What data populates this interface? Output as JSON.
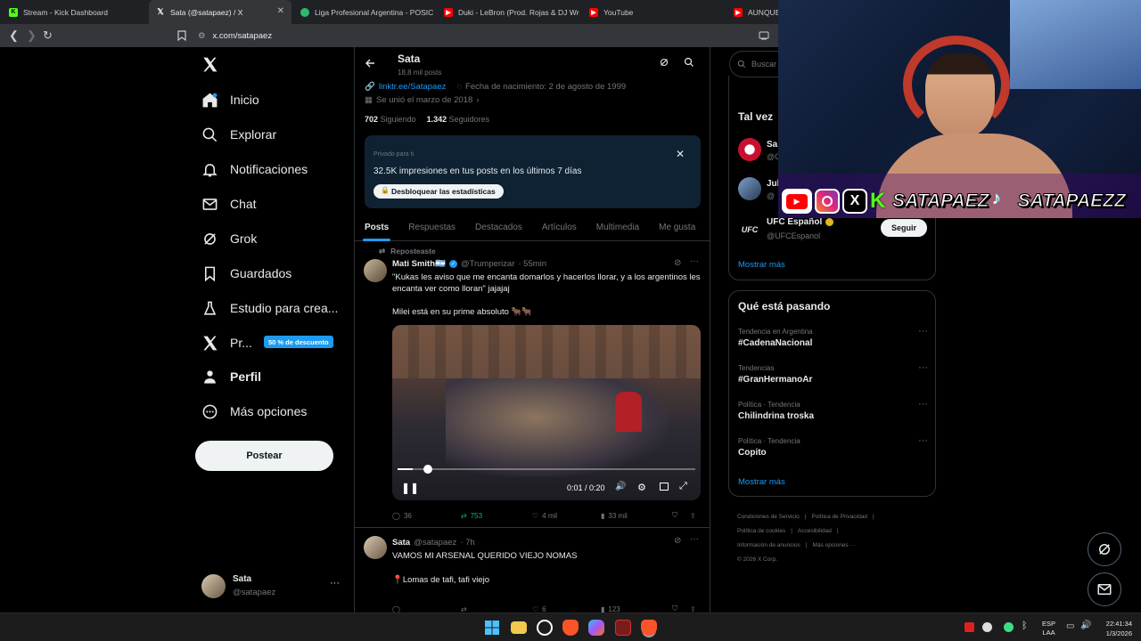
{
  "browser": {
    "tabs": [
      {
        "label": "Stream - Kick Dashboard",
        "icon": "kick-icon",
        "color": "#53fc18"
      },
      {
        "label": "Sata (@satapaez) / X",
        "icon": "x-icon",
        "color": "#ffffff"
      },
      {
        "label": "Liga Profesional Argentina - POSICIO",
        "icon": "liga-icon",
        "color": "#2eb872"
      },
      {
        "label": "Duki - LeBron (Prod. Rojas & DJ Wre",
        "icon": "youtube-icon",
        "color": "#ff0000"
      },
      {
        "label": "YouTube",
        "icon": "youtube-icon",
        "color": "#ff0000"
      },
      {
        "label": "AUNQUE",
        "icon": "youtube-icon",
        "color": "#ff0000"
      }
    ],
    "url": "x.com/satapaez"
  },
  "nav": {
    "items": [
      {
        "label": "Inicio",
        "icon": "home-icon"
      },
      {
        "label": "Explorar",
        "icon": "search-icon"
      },
      {
        "label": "Notificaciones",
        "icon": "bell-icon"
      },
      {
        "label": "Chat",
        "icon": "mail-icon"
      },
      {
        "label": "Grok",
        "icon": "grok-icon"
      },
      {
        "label": "Guardados",
        "icon": "bookmark-icon"
      },
      {
        "label": "Estudio para crea...",
        "icon": "flask-icon"
      },
      {
        "label": "Pr...",
        "icon": "x-logo-icon"
      },
      {
        "label": "Perfil",
        "icon": "person-icon"
      },
      {
        "label": "Más opciones",
        "icon": "more-circle-icon"
      }
    ],
    "premium_badge": "50 % de descuento",
    "post_button": "Postear",
    "account": {
      "name": "Sata",
      "handle": "@satapaez",
      "more": "···"
    }
  },
  "profile": {
    "name": "Sata",
    "posts_count": "18,8 mil posts",
    "link": "linktr.ee/Satapaez",
    "birthday": "Fecha de nacimiento: 2 de agosto de 1999",
    "joined": "Se unió el marzo de 2018",
    "following_count": "702",
    "following_label": "Siguiendo",
    "followers_count": "1.342",
    "followers_label": "Seguidores",
    "promo": {
      "kicker": "Privado para ti",
      "text": "32.5K impresiones en tus posts en los últimos 7 días",
      "button": "Desbloquear las estadísticas"
    },
    "tabs": [
      "Posts",
      "Respuestas",
      "Destacados",
      "Artículos",
      "Multimedia",
      "Me gusta"
    ]
  },
  "posts": [
    {
      "repost_label": "Reposteaste",
      "author": "Mati Smith🇦🇷",
      "handle": "@Trumperizar",
      "time": "· 55min",
      "text1": "\"Kukas les aviso que me encanta domarlos y hacerlos llorar, y a los argentinos les encanta ver como lloran\" jajajaj",
      "text2": "Milei está en su prime absoluto 🐂🐂",
      "video_time": "0:01 / 0:20",
      "video_progress": 0.05,
      "replies": "36",
      "reposts": "753",
      "likes": "4 mil",
      "views": "33 mil"
    },
    {
      "author": "Sata",
      "handle": "@satapaez",
      "time": "· 7h",
      "text1": "VAMOS MI ARSENAL QUERIDO VIEJO NOMAS",
      "text2": "📍Lomas de tafi, tafi viejo",
      "replies": "",
      "reposts": "",
      "likes": "6",
      "views": "123"
    }
  ],
  "sidebar": {
    "search_placeholder": "Buscar",
    "who_to_follow_title": "Tal vez",
    "suggestions": [
      {
        "name": "Sa",
        "handle": "@C"
      },
      {
        "name": "Jul",
        "handle": "@"
      },
      {
        "name": "UFC Español",
        "handle": "@UFCEspanol",
        "button": "Seguir"
      }
    ],
    "show_more": "Mostrar más",
    "trends_title": "Qué está pasando",
    "trends": [
      {
        "meta": "Tendencia en Argentina",
        "name": "#CadenaNacional"
      },
      {
        "meta": "Tendencias",
        "name": "#GranHermanoAr"
      },
      {
        "meta": "Política · Tendencia",
        "name": "Chilindrina troska"
      },
      {
        "meta": "Política · Tendencia",
        "name": "Copito"
      }
    ],
    "footer": [
      "Condiciones de Servicio",
      "Política de Privacidad",
      "Política de cookies",
      "Accesibilidad",
      "Información de anuncios",
      "Más opciones ···",
      "© 2026 X Corp."
    ]
  },
  "overlay": {
    "handle1": "SATAPAEZ",
    "handle2": "SATAPAEZZ"
  },
  "taskbar": {
    "lang1": "ESP",
    "lang2": "LAA",
    "time": "22:41:34",
    "date": "1/3/2026"
  }
}
